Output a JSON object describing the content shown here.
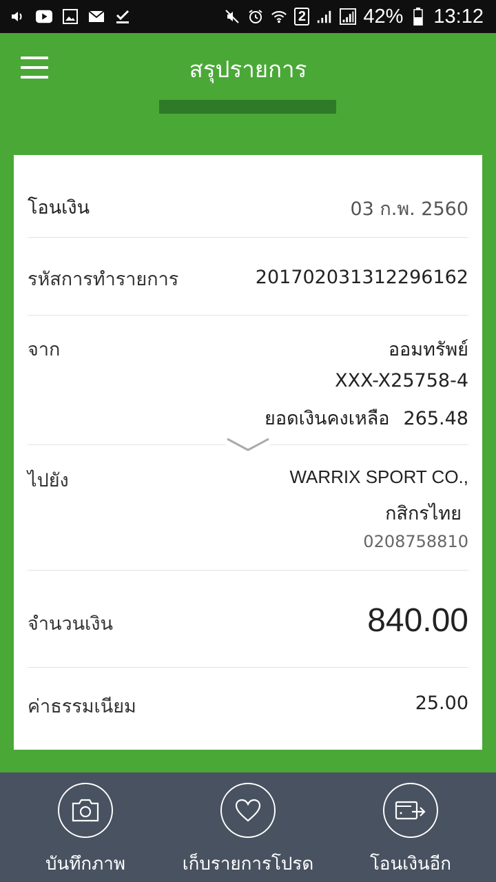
{
  "status_bar": {
    "time": "13:12",
    "battery": "42%",
    "sim_badge": "2",
    "left_icons": [
      "volume-icon",
      "youtube-icon",
      "gallery-icon",
      "mail-icon",
      "download-done-icon"
    ],
    "right_icons": [
      "mute-icon",
      "alarm-icon",
      "wifi-icon",
      "sim-icon",
      "signal-icon",
      "signal-icon",
      "battery-icon"
    ]
  },
  "header": {
    "title": "สรุปรายการ",
    "menu_icon": "hamburger-menu-icon",
    "accent": "#4aa837"
  },
  "summary": {
    "transfer": {
      "label": "โอนเงิน",
      "value": "03 ก.พ. 2560"
    },
    "reference": {
      "label": "รหัสการทำรายการ",
      "value": "20170203131229616 2"
    },
    "from": {
      "label": "จาก",
      "account_type": "ออมทรัพย์",
      "account_number": "XXX-X25758-4",
      "balance_label": "ยอดเงินคงเหลือ",
      "balance_value": "265.48"
    },
    "to": {
      "label": "ไปยัง",
      "name": "WARRIX SPORT CO.,",
      "bank": "กสิกรไทย",
      "account_number": "0208758810"
    },
    "amount": {
      "label": "จำนวนเงิน",
      "value": "840.00"
    },
    "fee": {
      "label": "ค่าธรรมเนียม",
      "value": "25.00"
    }
  },
  "bottom_bar": {
    "background": "#485261",
    "items": [
      {
        "label": "บันทึกภาพ",
        "icon": "camera-icon"
      },
      {
        "label": "เก็บรายการโปรด",
        "icon": "heart-icon"
      },
      {
        "label": "โอนเงินอีก",
        "icon": "wallet-transfer-icon"
      }
    ]
  }
}
